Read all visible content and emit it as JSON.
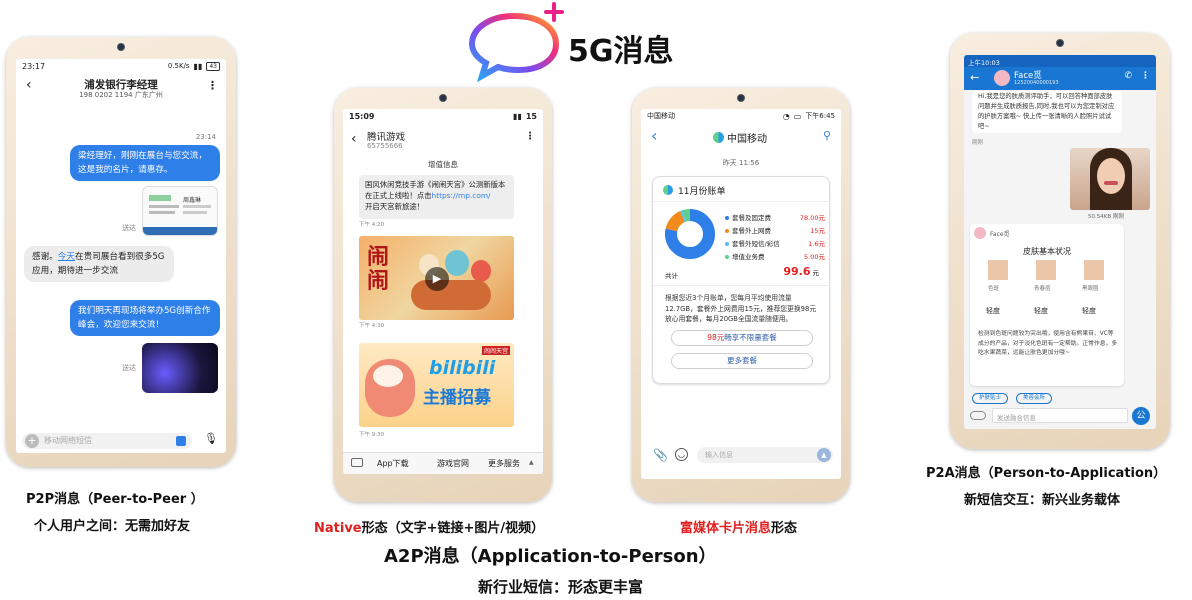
{
  "brand": {
    "title": "5G消息",
    "ring_colors": [
      "#2aa7f3",
      "#7a4cf0",
      "#f0307a",
      "#ffb020"
    ],
    "plus_color": "#e8208a"
  },
  "colors": {
    "blue": "#2f7fe8",
    "red": "#e02020",
    "orange": "#f28b1e",
    "donut": [
      "#2f7fe8",
      "#f28b1e",
      "#4fc1ee",
      "#5fcf8e"
    ]
  },
  "phone1": {
    "status_time": "23:17",
    "status_speed": "0.5K/s",
    "status_battery": "43",
    "contact": "浦发银行李经理",
    "contact_sub": "198 0202 1194 广东广州",
    "time1": "23:14",
    "msg1": "梁经理好，刚刚在展台与您交流，这是我的名片，请惠存。",
    "sent1": "送达",
    "card_name": "周鑫琳",
    "msg2_pre": "感谢。",
    "msg2_link": "今天",
    "msg2_post": "在贵司展台看到很多5G应用，期待进一步交流",
    "msg3": "我们明天再现场将举办5G创新合作峰会，欢迎您来交流！",
    "sent2": "送达",
    "input_placeholder": "移动网络短信"
  },
  "phone2": {
    "status_time": "15:09",
    "status_battery": "15",
    "contact": "腾讯游戏",
    "contact_sub": "65755666",
    "section_title": "增值信息",
    "msg_text": "国风休闲竞技手游《闹闹天宫》公测新版本在正式上线啦！点击",
    "msg_link": "https://mp.com/",
    "msg_text2": "开启天宫新旅途！",
    "ts1": "下午 4:20",
    "ts2": "下午 4:30",
    "ts3": "下午 9:30",
    "game_logo": "闹闹",
    "banner_line1": "bilibili",
    "banner_line2": "主播招募",
    "banner_tag": "闹闹天宫",
    "menu": [
      "App下载",
      "游戏官网",
      "更多服务"
    ]
  },
  "phone3": {
    "status_left": "中国移动",
    "status_time": "下午6:45",
    "contact": "中国移动",
    "date": "昨天 11:56",
    "card_title": "11月份账单",
    "legend": [
      {
        "label": "套餐及固定费",
        "value": "78.00元"
      },
      {
        "label": "套餐外上网费",
        "value": "15元"
      },
      {
        "label": "套餐外短信/彩信",
        "value": "1.6元"
      },
      {
        "label": "增值业务费",
        "value": "5.00元"
      }
    ],
    "donut_values": [
      78,
      15,
      1.6,
      5
    ],
    "total_label": "共计",
    "total_value": "99.6",
    "total_unit": "元",
    "advice": "根据您近3个月账单，您每月平均使用流量12.7GB，套餐外上网费用15元，推荐您更换98元放心用套餐，每月20GB全国流量随便用。",
    "btn1_red": "98元",
    "btn1_rest": "畅享不限量套餐",
    "btn2": "更多套餐",
    "input_placeholder": "输入信息"
  },
  "phone4": {
    "status_time": "上午10:03",
    "contact": "Face觅",
    "contact_sub": "12520040000193",
    "top_text": "Hi,我是您的肤质测评助手，可以回答种面部皮肤问题并生成肤质报告,同时,我也可以为您定制对应的护肤方案哦~ 快上传一张清晰的人脸照片试试吧~",
    "read1": "刚刚",
    "photo_size": "50.54KB",
    "photo_read": "刚刚",
    "card_sender": "Face觅",
    "card_title": "皮肤基本状况",
    "labels": [
      "色斑",
      "青春痘",
      "黑眼圈"
    ],
    "levels": [
      "轻度",
      "轻度",
      "轻度"
    ],
    "desc": "检测到色斑问题较为突出哦，使用含有熊果苷、VC等成分的产品，对于淡化色斑有一定帮助。正常作息，多吃水果蔬菜，远能让肤色更加分哦~",
    "chips": [
      "护肤贴士",
      "美容会所"
    ],
    "input_placeholder": "发送融合信息"
  },
  "captions": {
    "p2p_title": "P2P消息（Peer-to-Peer ）",
    "p2p_sub": "个人用户之间：无需加好友",
    "native_red": "Native",
    "native_rest": "形态（文字+链接+图片/视频）",
    "rich_red": "富媒体卡片消息",
    "rich_rest": "形态",
    "a2p_title": "A2P消息（Application-to-Person）",
    "a2p_sub": "新行业短信：形态更丰富",
    "p2a_title": "P2A消息（Person-to-Application）",
    "p2a_sub": "新短信交互：新兴业务载体"
  }
}
